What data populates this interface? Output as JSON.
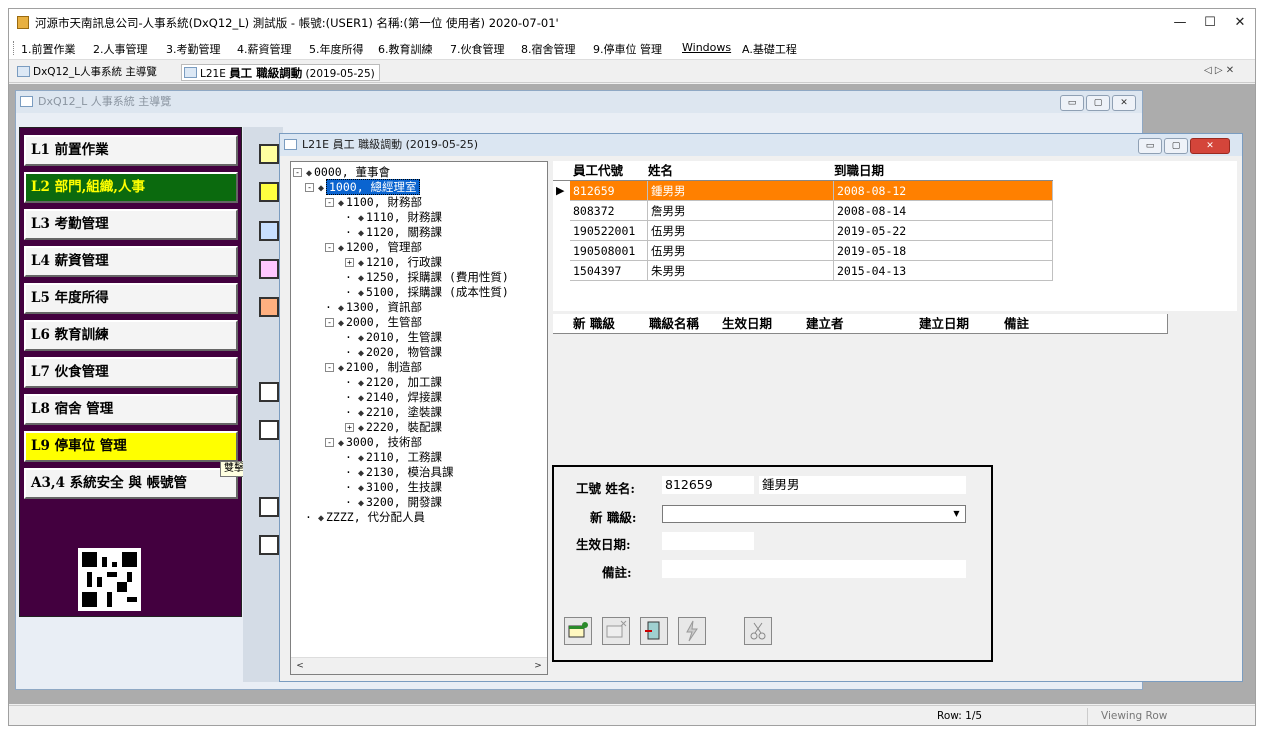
{
  "window": {
    "title": "河源市天南訊息公司-人事系統(DxQ12_L) 測試版 - 帳號:(USER1) 名稱:(第一位 使用者) 2020-07-01'",
    "minimize": "—",
    "maximize": "☐",
    "close": "✕"
  },
  "menu": [
    "1.前置作業",
    "2.人事管理",
    "3.考勤管理",
    "4.薪資管理",
    "5.年度所得",
    "6.教育訓練",
    "7.伙食管理",
    "8.宿舍管理",
    "9.停車位 管理",
    "Windows",
    "A.基礎工程"
  ],
  "doc_tabs": {
    "tab1": "DxQ12_L人事系統 主導覽",
    "tab2_prefix": "L21E ",
    "tab2_main": "員工 職級調動",
    "tab2_date": " (2019-05-25)",
    "nav_glyphs": "◁ ▷ ✕"
  },
  "nav_window": {
    "title": "DxQ12_L 人事系統 主導覽",
    "buttons": [
      "L1 前置作業",
      "L2 部門,組織,人事",
      "L3 考勤管理",
      "L4 薪資管理",
      "L5 年度所得",
      "L6 教育訓練",
      "L7 伙食管理",
      "L8 宿舍 管理",
      "L9 停車位 管理",
      "A3,4 系統安全 與 帳號管"
    ],
    "tooltip": "雙擊"
  },
  "job_window": {
    "title": "L21E 員工 職級調動 (2019-05-25)"
  },
  "tree": [
    {
      "label": "0000, 董事會",
      "level": 0,
      "exp": "-"
    },
    {
      "label": "1000, 總經理室",
      "level": 1,
      "exp": "-",
      "selected": true
    },
    {
      "label": "1100, 財務部",
      "level": 2,
      "exp": "-"
    },
    {
      "label": "1110, 財務課",
      "level": 3,
      "exp": ""
    },
    {
      "label": "1120, 關務課",
      "level": 3,
      "exp": ""
    },
    {
      "label": "1200, 管理部",
      "level": 2,
      "exp": "-"
    },
    {
      "label": "1210, 行政課",
      "level": 3,
      "exp": "+"
    },
    {
      "label": "1250, 採購課 (費用性質)",
      "level": 3,
      "exp": ""
    },
    {
      "label": "5100, 採購課 (成本性質)",
      "level": 3,
      "exp": ""
    },
    {
      "label": "1300, 資訊部",
      "level": 2,
      "exp": ""
    },
    {
      "label": "2000, 生管部",
      "level": 2,
      "exp": "-"
    },
    {
      "label": "2010, 生管課",
      "level": 3,
      "exp": ""
    },
    {
      "label": "2020, 物管課",
      "level": 3,
      "exp": ""
    },
    {
      "label": "2100, 制造部",
      "level": 2,
      "exp": "-"
    },
    {
      "label": "2120, 加工課",
      "level": 3,
      "exp": ""
    },
    {
      "label": "2140, 焊接課",
      "level": 3,
      "exp": ""
    },
    {
      "label": "2210, 塗裝課",
      "level": 3,
      "exp": ""
    },
    {
      "label": "2220, 裝配課",
      "level": 3,
      "exp": "+"
    },
    {
      "label": "3000, 技術部",
      "level": 2,
      "exp": "-"
    },
    {
      "label": "2110, 工務課",
      "level": 3,
      "exp": ""
    },
    {
      "label": "2130, 模治具課",
      "level": 3,
      "exp": ""
    },
    {
      "label": "3100, 生技課",
      "level": 3,
      "exp": ""
    },
    {
      "label": "3200, 開發課",
      "level": 3,
      "exp": ""
    },
    {
      "label": "ZZZZ, 代分配人員",
      "level": 1,
      "exp": ""
    }
  ],
  "employees": {
    "columns": [
      "員工代號",
      "姓名",
      "到職日期"
    ],
    "rows": [
      {
        "id": "812659",
        "name": "鍾男男",
        "date": "2008-08-12",
        "selected": true
      },
      {
        "id": "808372",
        "name": "詹男男",
        "date": "2008-08-14"
      },
      {
        "id": "190522001",
        "name": "伍男男",
        "date": "2019-05-22"
      },
      {
        "id": "190508001",
        "name": "伍男男",
        "date": "2019-05-18"
      },
      {
        "id": "1504397",
        "name": "朱男男",
        "date": "2015-04-13"
      }
    ],
    "pointer": "▶"
  },
  "history": {
    "columns": [
      "新 職級",
      "職級名稱",
      "生效日期",
      "建立者",
      "建立日期",
      "備註"
    ]
  },
  "form": {
    "emp_label": "工號 姓名:",
    "emp_id": "812659",
    "emp_name": "鍾男男",
    "grade_label": "新 職級:",
    "grade_value": "",
    "date_label": "生效日期:",
    "date_value": "",
    "note_label": "備註:",
    "note_value": ""
  },
  "status": {
    "row": "Row: 1/5",
    "mode": "Viewing Row"
  }
}
